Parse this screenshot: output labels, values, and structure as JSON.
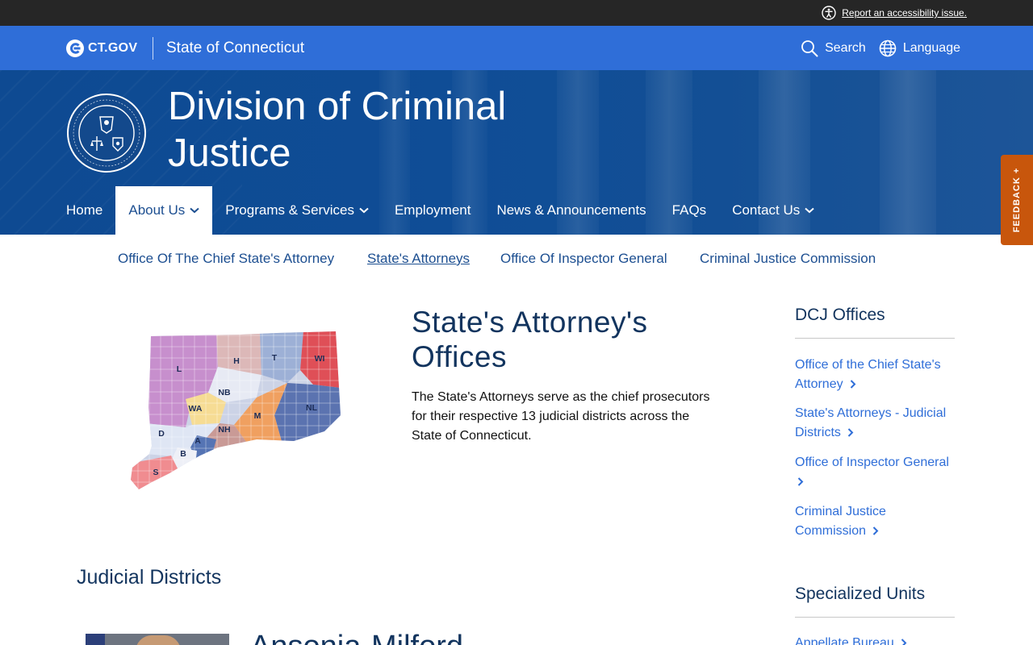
{
  "utility": {
    "a11y_link": "Report an accessibility issue."
  },
  "ctbar": {
    "logo_text": "CT.GOV",
    "site_name": "State of Connecticut",
    "search_label": "Search",
    "language_label": "Language"
  },
  "hero": {
    "agency_title": "Division of Criminal Justice"
  },
  "main_nav": [
    {
      "label": "Home",
      "dropdown": false
    },
    {
      "label": "About Us",
      "dropdown": true,
      "active": true
    },
    {
      "label": "Programs & Services",
      "dropdown": true
    },
    {
      "label": "Employment",
      "dropdown": false
    },
    {
      "label": "News & Announcements",
      "dropdown": false
    },
    {
      "label": "FAQs",
      "dropdown": false
    },
    {
      "label": "Contact Us",
      "dropdown": true
    }
  ],
  "feedback": {
    "label": "FEEDBACK +"
  },
  "sub_nav": [
    {
      "label": "Office Of The Chief State's Attorney"
    },
    {
      "label": "State's Attorneys",
      "current": true
    },
    {
      "label": "Office Of Inspector General"
    },
    {
      "label": "Criminal Justice Commission"
    }
  ],
  "map": {
    "district_labels": [
      "L",
      "H",
      "T",
      "WI",
      "NB",
      "WA",
      "NL",
      "M",
      "NH",
      "D",
      "A",
      "B",
      "S"
    ]
  },
  "main": {
    "title": "State's Attorney's Offices",
    "intro": "The State's Attorneys serve as the chief prosecutors for their respective 13 judicial districts across the State of Connecticut.",
    "section_heading": "Judicial Districts",
    "first_district_title": "Ansonia-Milford"
  },
  "sidebar": {
    "offices_heading": "DCJ Offices",
    "offices_links": [
      "Office of the Chief State's Attorney",
      "State's Attorneys - Judicial Districts",
      "Office of Inspector General",
      "Criminal Justice Commission"
    ],
    "units_heading": "Specialized Units",
    "units_links": [
      "Appellate Bureau"
    ]
  },
  "colors": {
    "ct_blue": "#2f6ed8",
    "hero_blue": "#0f4d96",
    "nav_text_active": "#1d4f91",
    "link_blue": "#2f6ed8",
    "heading_navy": "#12345e",
    "feedback_orange": "#c8560c",
    "utility_bar": "#262626"
  },
  "icons": [
    "accessibility-icon",
    "ctgov-logo-icon",
    "search-icon",
    "globe-icon",
    "state-seal-icon",
    "chevron-down-icon",
    "chevron-right-icon"
  ]
}
